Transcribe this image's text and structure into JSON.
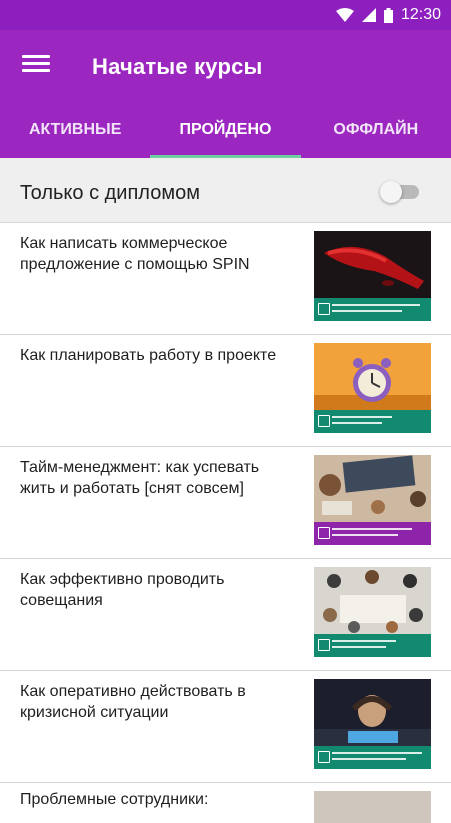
{
  "status_bar": {
    "time": "12:30",
    "icons": [
      "wifi-icon",
      "signal-icon",
      "battery-icon"
    ]
  },
  "header": {
    "title": "Начатые курсы",
    "menu_icon": "hamburger-menu-icon"
  },
  "tabs": [
    {
      "label": "АКТИВНЫЕ",
      "active": false
    },
    {
      "label": "ПРОЙДЕНО",
      "active": true
    },
    {
      "label": "ОФФЛАЙН",
      "active": false
    }
  ],
  "filter": {
    "label": "Только с дипломом",
    "enabled": false
  },
  "courses": [
    {
      "title": "Как написать коммерческое предложение с помощью SPIN"
    },
    {
      "title": "Как планировать работу в проекте"
    },
    {
      "title": "Тайм-менеджмент: как успевать жить и работать [снят совсем]"
    },
    {
      "title": "Как эффективно проводить совещания"
    },
    {
      "title": "Как оперативно действовать в кризисной ситуации"
    },
    {
      "title": "Проблемные сотрудники:"
    }
  ],
  "colors": {
    "status_bar": "#8e1fbf",
    "app_bar": "#9c27c0",
    "tab_indicator": "#6ed0a0",
    "course_band_green": "#128a6f",
    "course_band_purple": "#8e24aa"
  }
}
